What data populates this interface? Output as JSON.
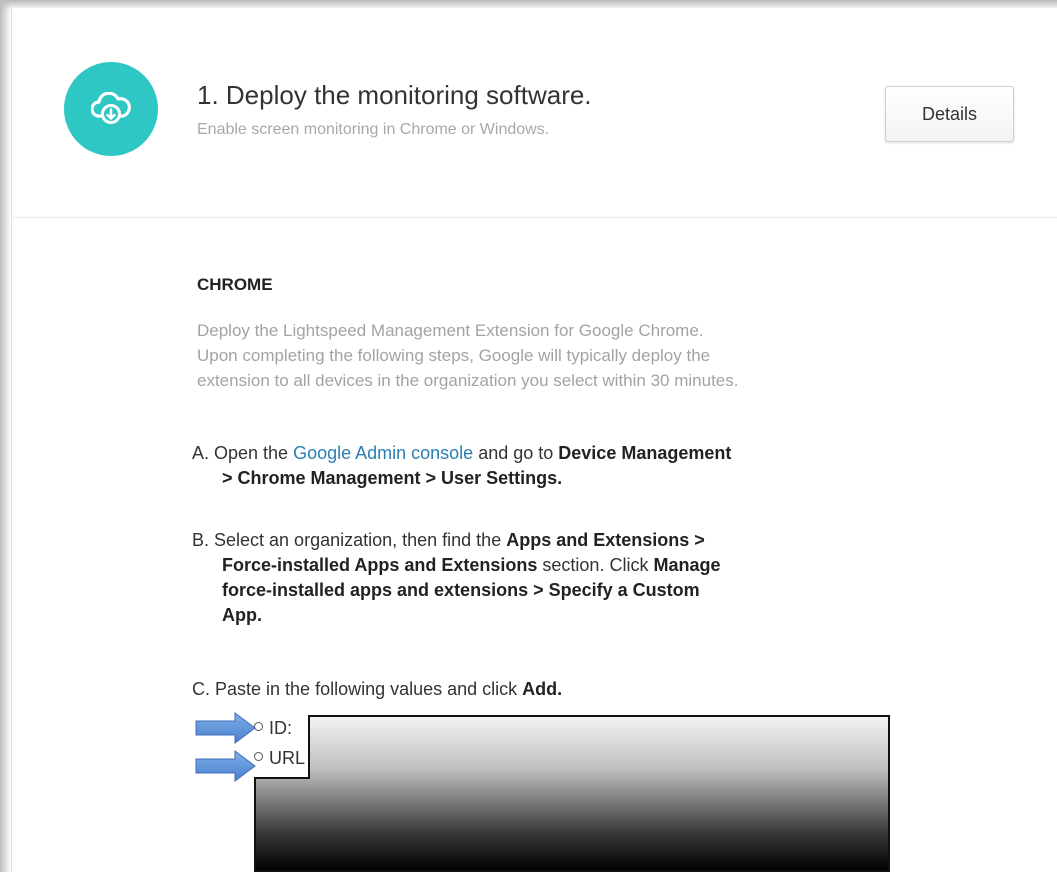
{
  "header": {
    "icon": "cloud-download-icon",
    "icon_color": "#2ec7c4",
    "title": "1. Deploy the monitoring software.",
    "subtitle": "Enable screen monitoring in Chrome or Windows.",
    "details_label": "Details"
  },
  "chrome": {
    "heading": "CHROME",
    "intro_lines": [
      "Deploy the Lightspeed Management Extension for Google Chrome.",
      "Upon completing the following steps, Google will typically deploy the",
      "extension to all devices in the organization you select within 30 minutes."
    ],
    "step_a": {
      "prefix": "A. Open the ",
      "link": "Google Admin console",
      "mid": " and go to ",
      "bold_1": "Device Management",
      "bold_2": "> Chrome Management > User Settings."
    },
    "step_b": {
      "prefix": "B. Select an organization, then find the ",
      "bold_1": "Apps and Extensions >",
      "bold_2": "Force-installed Apps and Extensions",
      "mid": " section. Click ",
      "bold_3": "Manage",
      "bold_4": "force-installed apps and extensions > Specify a Custom",
      "bold_5": "App."
    },
    "step_c": {
      "prefix": "C. Paste in the following values and click ",
      "bold": "Add."
    },
    "bullets": [
      {
        "label": "ID:"
      },
      {
        "label": "URL"
      }
    ],
    "annotation_color": "#5b8fd6"
  }
}
